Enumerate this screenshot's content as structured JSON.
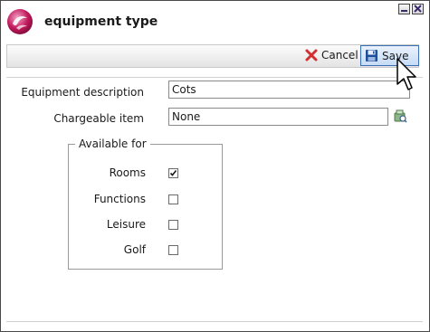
{
  "window": {
    "title": "equipment type",
    "minimize_icon": "minimize-icon",
    "close_icon": "close-icon"
  },
  "toolbar": {
    "cancel_label": "Cancel",
    "cancel_icon": "red-x-icon",
    "save_label": "Save",
    "save_icon": "floppy-disk-icon"
  },
  "form": {
    "equipment_description": {
      "label": "Equipment description",
      "value": "Cots"
    },
    "chargeable_item": {
      "label": "Chargeable item",
      "value": "None",
      "lookup_icon": "lookup-icon"
    }
  },
  "available_for": {
    "title": "Available for",
    "options": [
      {
        "label": "Rooms",
        "checked": true
      },
      {
        "label": "Functions",
        "checked": false
      },
      {
        "label": "Leisure",
        "checked": false
      },
      {
        "label": "Golf",
        "checked": false
      }
    ]
  },
  "colors": {
    "accent_pink": "#c2185b",
    "cancel_red": "#d32f2f",
    "save_highlight": "#c6dbf6"
  }
}
